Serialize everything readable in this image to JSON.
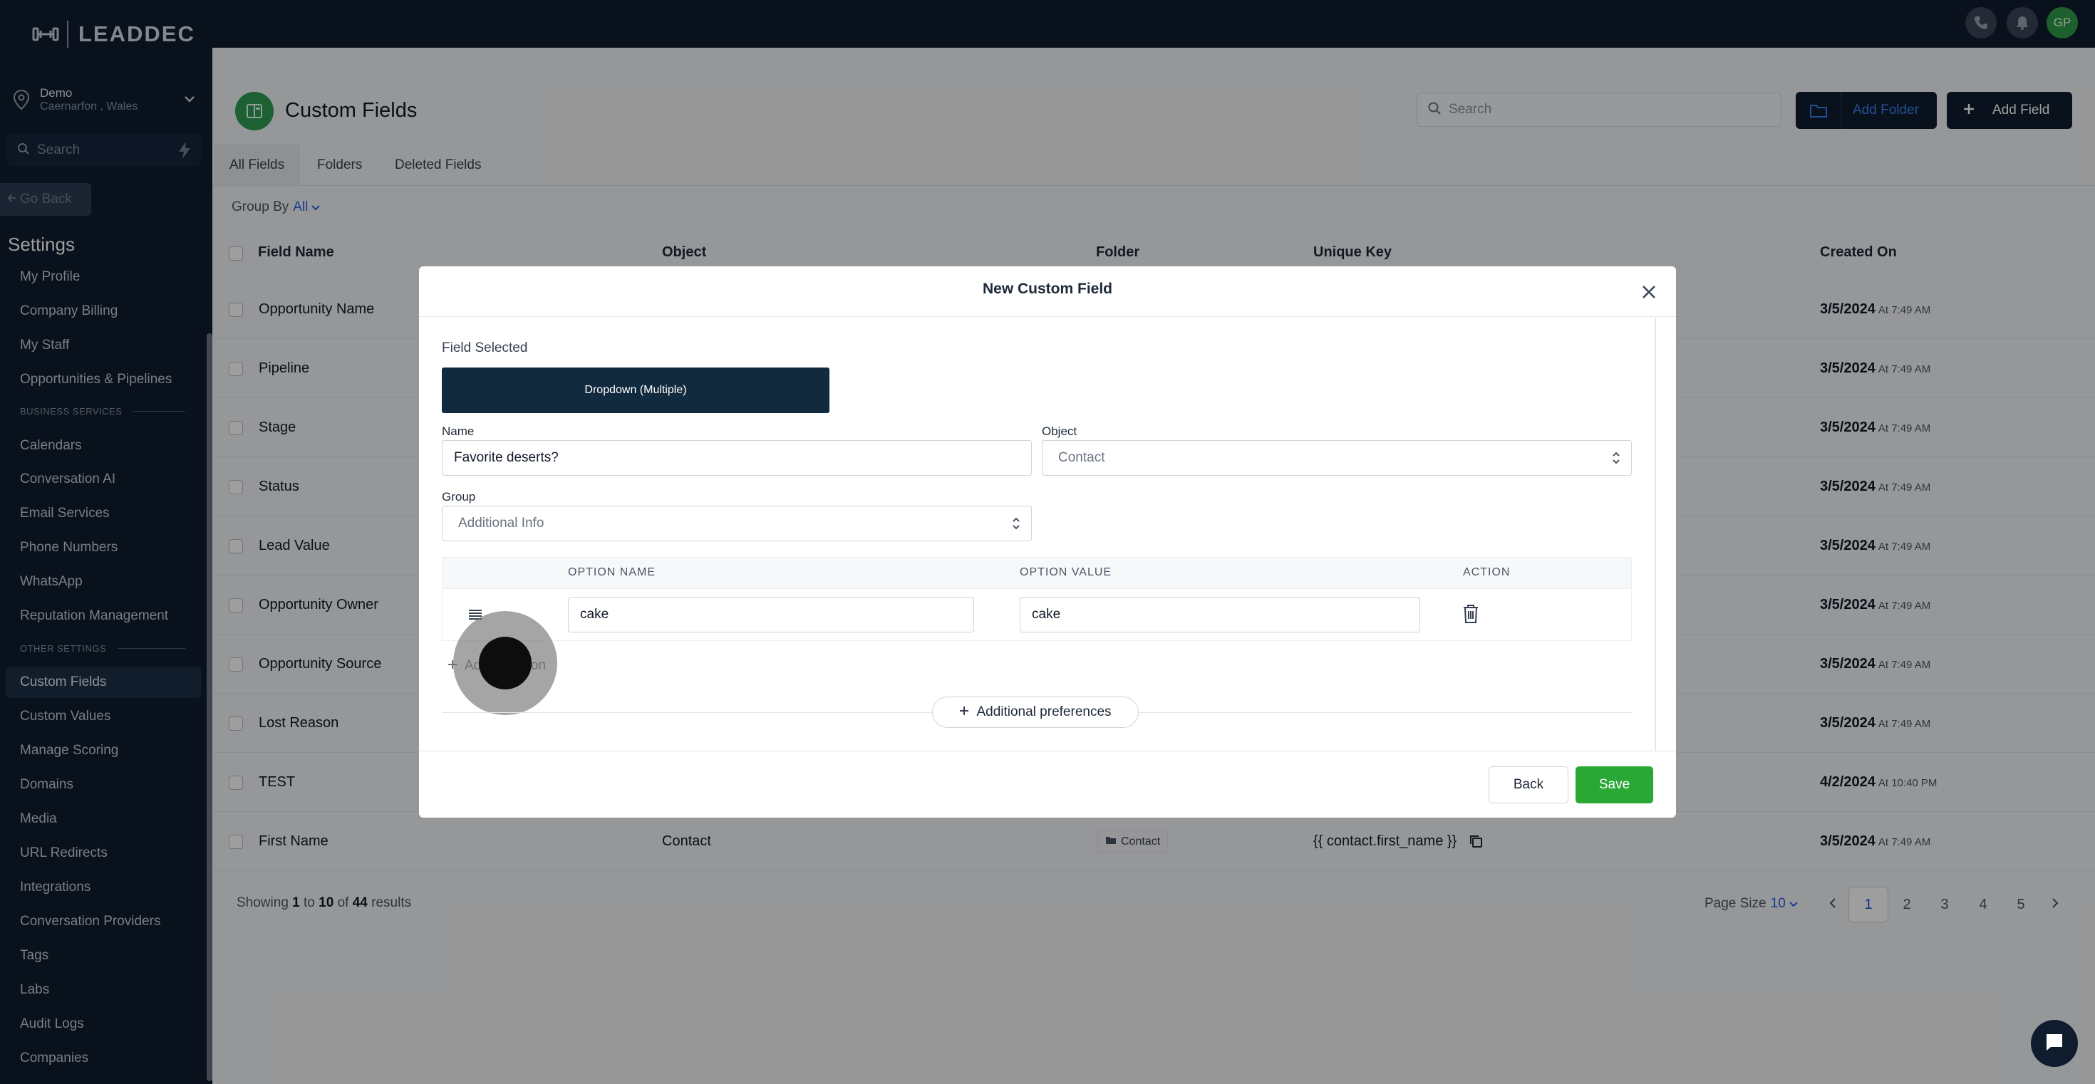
{
  "brand": {
    "name": "LEADDEC"
  },
  "location": {
    "name": "Demo",
    "sub": "Caernarfon , Wales"
  },
  "sidebar": {
    "search_placeholder": "Search",
    "go_back": "Go Back",
    "settings_title": "Settings",
    "items_top": [
      "My Profile",
      "Company Billing",
      "My Staff",
      "Opportunities & Pipelines"
    ],
    "section_business": "BUSINESS SERVICES",
    "items_business": [
      "Calendars",
      "Conversation AI",
      "Email Services",
      "Phone Numbers",
      "WhatsApp",
      "Reputation Management"
    ],
    "section_other": "OTHER SETTINGS",
    "items_other": [
      "Custom Fields",
      "Custom Values",
      "Manage Scoring",
      "Domains",
      "Media",
      "URL Redirects",
      "Integrations",
      "Conversation Providers",
      "Tags",
      "Labs",
      "Audit Logs",
      "Companies"
    ]
  },
  "topbar": {
    "avatar_initials": "GP"
  },
  "header": {
    "title": "Custom Fields",
    "search_placeholder": "Search",
    "add_folder": "Add Folder",
    "add_field": "Add Field"
  },
  "tabs": [
    "All Fields",
    "Folders",
    "Deleted Fields"
  ],
  "group_by": {
    "label": "Group By",
    "value": "All"
  },
  "table": {
    "headers": [
      "Field Name",
      "Object",
      "Folder",
      "Unique Key",
      "Created On"
    ],
    "rows": [
      {
        "name": "Opportunity Name",
        "date": "3/5/2024",
        "time": "At 7:49 AM"
      },
      {
        "name": "Pipeline",
        "date": "3/5/2024",
        "time": "At 7:49 AM"
      },
      {
        "name": "Stage",
        "date": "3/5/2024",
        "time": "At 7:49 AM"
      },
      {
        "name": "Status",
        "date": "3/5/2024",
        "time": "At 7:49 AM"
      },
      {
        "name": "Lead Value",
        "date": "3/5/2024",
        "time": "At 7:49 AM"
      },
      {
        "name": "Opportunity Owner",
        "date": "3/5/2024",
        "time": "At 7:49 AM"
      },
      {
        "name": "Opportunity Source",
        "date": "3/5/2024",
        "time": "At 7:49 AM"
      },
      {
        "name": "Lost Reason",
        "date": "3/5/2024",
        "time": "At 7:49 AM"
      },
      {
        "name": "TEST",
        "date": "4/2/2024",
        "time": "At 10:40 PM"
      },
      {
        "name": "First Name",
        "object": "Contact",
        "folder": "Contact",
        "key": "{{ contact.first_name }}",
        "date": "3/5/2024",
        "time": "At 7:49 AM"
      }
    ]
  },
  "footer": {
    "showing_prefix": "Showing",
    "showing_from": "1",
    "showing_to_word": "to",
    "showing_to": "10",
    "showing_of_word": "of",
    "showing_total": "44",
    "showing_suffix": "results",
    "page_size_label": "Page Size",
    "page_size_value": "10",
    "pages": [
      "1",
      "2",
      "3",
      "4",
      "5"
    ]
  },
  "modal": {
    "title": "New Custom Field",
    "field_selected_label": "Field Selected",
    "field_type": "Dropdown (Multiple)",
    "name_label": "Name",
    "name_value": "Favorite deserts?",
    "object_label": "Object",
    "object_value": "Contact",
    "group_label": "Group",
    "group_value": "Additional Info",
    "options_headers": [
      "OPTION NAME",
      "OPTION VALUE",
      "ACTION"
    ],
    "option_name": "cake",
    "option_value": "cake",
    "add_option_start": "Ad",
    "add_option_end": "tion",
    "additional_preferences": "Additional preferences",
    "back": "Back",
    "save": "Save"
  },
  "colors": {
    "accent": "#1d4ed8",
    "save": "#2aa836",
    "dark": "#0f1c2e",
    "field_type_bg": "#122a3e"
  }
}
